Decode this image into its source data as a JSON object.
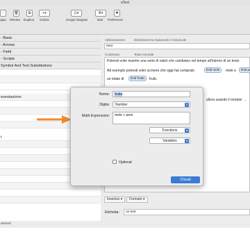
{
  "window": {
    "title": "aText"
  },
  "toolbar": {
    "items": [
      {
        "label": "uppo"
      },
      {
        "label": "Elimina"
      },
      {
        "label": "Duplica"
      },
      {
        "label": "Ordina"
      },
      {
        "label": "Gruppi integrati"
      },
      {
        "label": "Dati"
      },
      {
        "label": "Preferenze"
      }
    ]
  },
  "sidebar": {
    "rows": [
      "- Basic",
      "- Arrows",
      "- Field",
      "- Scripts",
      "Symbol And Text Substitutions",
      "",
      "",
      "",
      "esentazione",
      "",
      "",
      "",
      "",
      "t",
      "",
      "",
      "",
      "",
      "",
      "",
      "",
      "",
      ""
    ],
    "status": "elected"
  },
  "editor": {
    "abbreviation_label": "Abbreviazione:",
    "case_option": "Distinzione tra maiuscole e minuscole",
    "abbreviation_value": "!test",
    "content_label": "Contenuto:",
    "content_type": "Testo normale",
    "line1": "Potresti voler inserire una serie di valori che cambiano nel tempo all'interno di un testo",
    "line2a": "Ad esempio potresti voler scrivere che oggi hai comprato",
    "token1": "field mele",
    "line2b": "mele e",
    "token2": "field pe",
    "line3a": "un totale di",
    "token3": "field frutta",
    "line3b": "frutti.",
    "line4": "allora usando il modulo →",
    "insert_label": "Inserisci",
    "format_label": "Formato",
    "tag_label": "Etichetta:",
    "tag_value": "un test"
  },
  "dialog": {
    "name_label": "Nome:",
    "name_value": "frutta",
    "type_label": "Digita:",
    "type_value": "Number",
    "expr_label": "Math Expression:",
    "expr_value": "mele + pere",
    "functions_label": "Functions",
    "variables_label": "Variables",
    "optional_label": "Optional",
    "close_label": "Chiudi"
  },
  "colors": {
    "accent": "#3a7bd5",
    "annotation_arrow": "#f08a2c"
  }
}
